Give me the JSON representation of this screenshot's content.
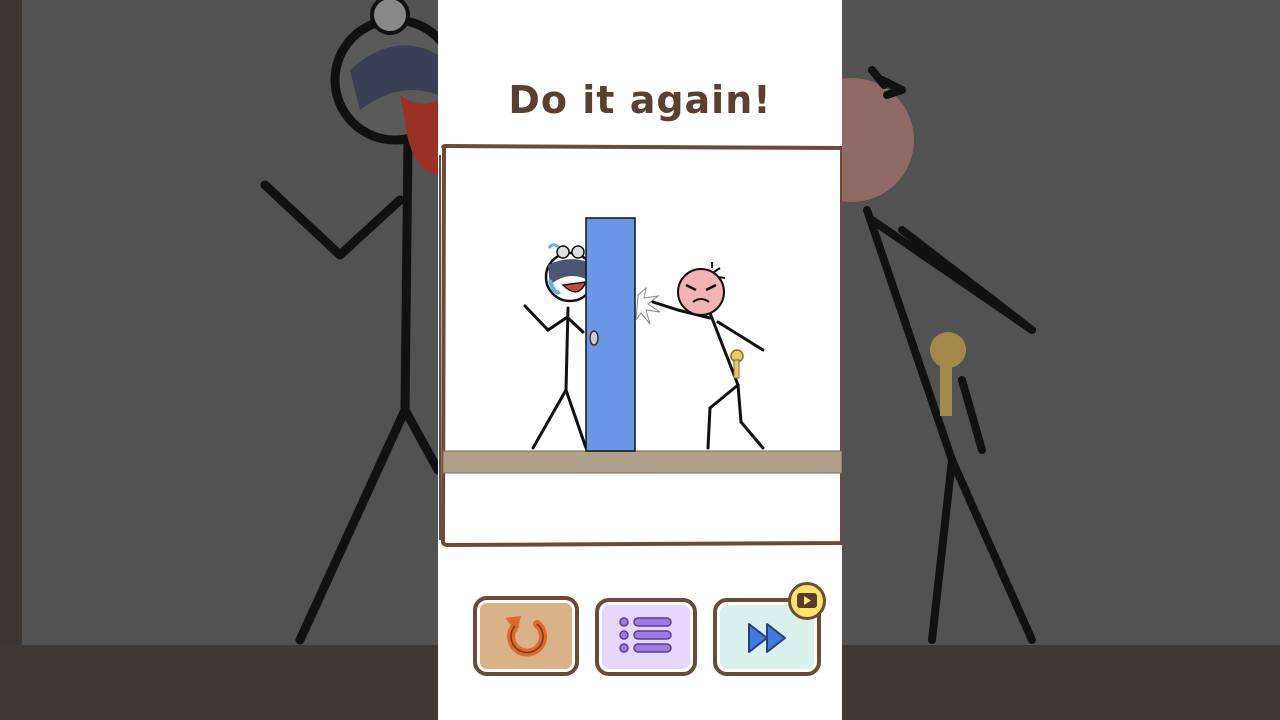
{
  "game": {
    "result_message": "Do it again!"
  },
  "buttons": {
    "retry": {
      "icon": "retry-arrow-icon",
      "color": "#d9b287"
    },
    "levels": {
      "icon": "list-menu-icon",
      "color": "#e6d6fb"
    },
    "skip": {
      "icon": "fast-forward-icon",
      "color": "#d8f1ec",
      "badge_icon": "video-ad-icon"
    }
  },
  "colors": {
    "door": "#6a96e6",
    "floor": "#b0a08c",
    "frame_border": "#6b4a3a",
    "text": "#5b3f2f",
    "angry_face": "#f3b3b3",
    "key": "#e7c96a"
  }
}
